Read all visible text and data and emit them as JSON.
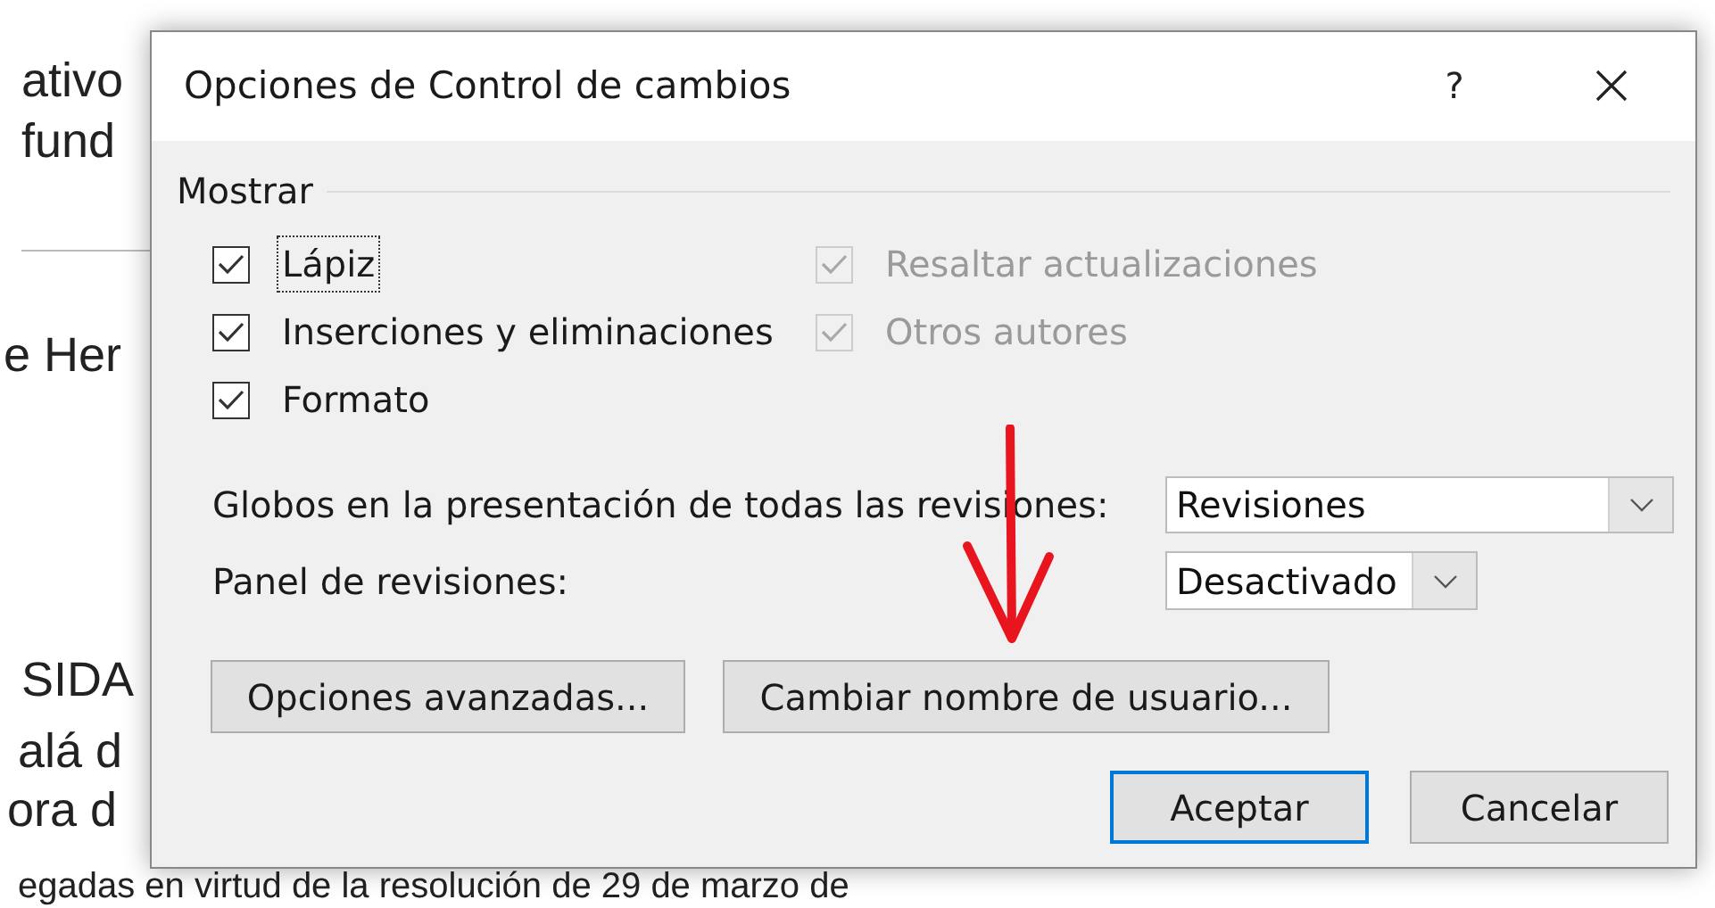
{
  "document": {
    "lines": [
      "ativo",
      "fund",
      "e Her",
      "SIDA",
      "alá d",
      "ora d",
      "egadas en virtud de la resolución de 29 de marzo de"
    ]
  },
  "dialog": {
    "title": "Opciones de Control de cambios",
    "help": "?",
    "group": {
      "label": "Mostrar",
      "checkboxes": [
        {
          "label": "Lápiz",
          "checked": true,
          "disabled": false,
          "focused": true
        },
        {
          "label": "Resaltar actualizaciones",
          "checked": true,
          "disabled": true,
          "focused": false
        },
        {
          "label": "Inserciones y eliminaciones",
          "checked": true,
          "disabled": false,
          "focused": false
        },
        {
          "label": "Otros autores",
          "checked": true,
          "disabled": true,
          "focused": false
        },
        {
          "label": "Formato",
          "checked": true,
          "disabled": false,
          "focused": false
        }
      ]
    },
    "dropdowns": [
      {
        "label": "Globos en la presentación de todas las revisiones:",
        "value": "Revisiones"
      },
      {
        "label": "Panel de revisiones:",
        "value": "Desactivado"
      }
    ],
    "option_buttons": [
      {
        "label": "Opciones avanzadas..."
      },
      {
        "label": "Cambiar nombre de usuario..."
      }
    ],
    "buttons": [
      {
        "label": "Aceptar",
        "default": true
      },
      {
        "label": "Cancelar",
        "default": false
      }
    ]
  },
  "annotation": {
    "kind": "arrow"
  }
}
